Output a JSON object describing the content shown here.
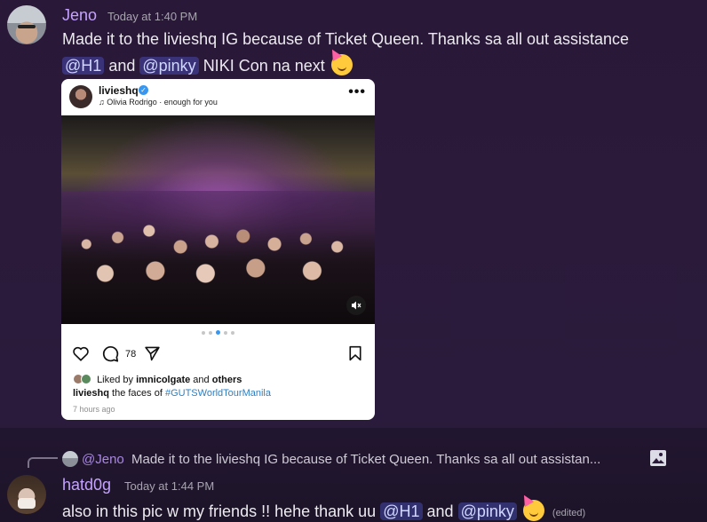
{
  "colors": {
    "username": "#c4a3ff",
    "mention_bg": "#5865f2",
    "instagram_link": "#2d7fc4",
    "verified_badge": "#3897f0"
  },
  "message_1": {
    "author": "Jeno",
    "timestamp": "Today at 1:40 PM",
    "line1": "Made it to the livieshq IG because of Ticket Queen. Thanks sa all out assistance",
    "mention_1": "@H1",
    "and_text": "and",
    "mention_2": "@pinky",
    "after_mentions": "NIKI Con na next",
    "emoji": "partying-face-emoji"
  },
  "instagram_embed": {
    "username": "livieshq",
    "verified_icon": "verified-check-icon",
    "music": "Olivia Rodrigo · enough for you",
    "music_icon": "music-note-icon",
    "more_label": "•••",
    "photo_description_icon": "concert-crowd-photo",
    "mute_label": "🔇",
    "carousel_pages": 5,
    "carousel_active": 3,
    "comment_count": "78",
    "liked_prefix": "Liked by",
    "liked_user": "imnicolgate",
    "liked_and": "and",
    "liked_others": "others",
    "caption_user": "livieshq",
    "caption_text": "the faces of",
    "caption_hashtag": "#GUTSWorldTourManila",
    "time_ago": "7 hours ago"
  },
  "message_2": {
    "reply_user": "@Jeno",
    "reply_text": "Made it to the livieshq IG because of Ticket Queen. Thanks sa all out assistan...",
    "reply_attachment_icon": "image-icon",
    "author": "hatd0g",
    "timestamp": "Today at 1:44 PM",
    "text_before": "also in this pic w my friends !! hehe thank uu",
    "mention_1": "@H1",
    "and_text": "and",
    "mention_2": "@pinky",
    "edited": "(edited)"
  }
}
